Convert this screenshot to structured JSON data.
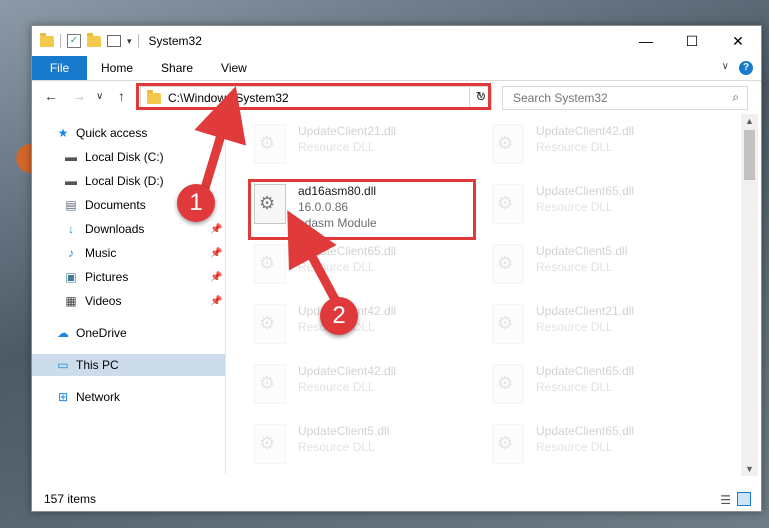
{
  "window": {
    "title": "System32",
    "controls": {
      "minimize": "—",
      "maximize": "☐",
      "close": "✕"
    }
  },
  "ribbon": {
    "tabs": [
      {
        "label": "File",
        "active": true
      },
      {
        "label": "Home"
      },
      {
        "label": "Share"
      },
      {
        "label": "View"
      }
    ],
    "help": "?"
  },
  "nav": {
    "back": "←",
    "forward": "→",
    "recent": "∨",
    "up": "↑",
    "address": "C:\\Windows\\System32",
    "search_placeholder": "Search System32"
  },
  "sidebar": {
    "items": [
      {
        "label": "Quick access",
        "icon": "star-icon",
        "pinned": false
      },
      {
        "label": "Local Disk (C:)",
        "icon": "drive-icon",
        "pinned": false
      },
      {
        "label": "Local Disk (D:)",
        "icon": "drive-icon",
        "pinned": false
      },
      {
        "label": "Documents",
        "icon": "document-icon",
        "pinned": false
      },
      {
        "label": "Downloads",
        "icon": "download-icon",
        "pinned": true
      },
      {
        "label": "Music",
        "icon": "music-icon",
        "pinned": true
      },
      {
        "label": "Pictures",
        "icon": "pictures-icon",
        "pinned": true
      },
      {
        "label": "Videos",
        "icon": "video-icon",
        "pinned": true
      },
      {
        "label": "OneDrive",
        "icon": "cloud-icon",
        "pinned": false
      },
      {
        "label": "This PC",
        "icon": "computer-icon",
        "pinned": false,
        "selected": true
      },
      {
        "label": "Network",
        "icon": "network-icon",
        "pinned": false
      }
    ]
  },
  "files": [
    {
      "name": "UpdateClient21.dll",
      "type": "Resource DLL"
    },
    {
      "name": "UpdateClient42.dll",
      "type": "Resource DLL"
    },
    {
      "name": "ad16asm80.dll",
      "version": "16.0.0.86",
      "type": "adasm Module",
      "highlighted": true
    },
    {
      "name": "UpdateClient65.dll",
      "type": "Resource DLL"
    },
    {
      "name": "UpdateClient65.dll",
      "type": "Resource DLL"
    },
    {
      "name": "UpdateClient5.dll",
      "type": "Resource DLL"
    },
    {
      "name": "UpdateClient42.dll",
      "type": "Resource DLL"
    },
    {
      "name": "UpdateClient21.dll",
      "type": "Resource DLL"
    },
    {
      "name": "UpdateClient42.dll",
      "type": "Resource DLL"
    },
    {
      "name": "UpdateClient65.dll",
      "type": "Resource DLL"
    },
    {
      "name": "UpdateClient5.dll",
      "type": "Resource DLL"
    },
    {
      "name": "UpdateClient65.dll",
      "type": "Resource DLL"
    }
  ],
  "status": {
    "item_count": "157 items"
  },
  "annotations": {
    "step1": "1",
    "step2": "2",
    "color": "#e03a3a"
  }
}
